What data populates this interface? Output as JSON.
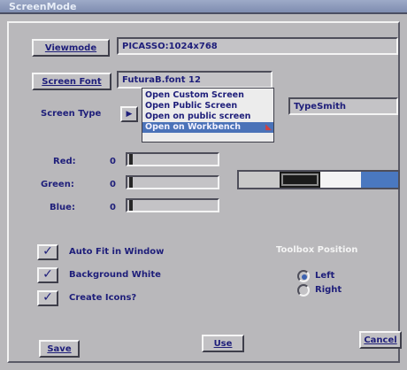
{
  "window": {
    "title": "ScreenMode"
  },
  "viewmode": {
    "button_label": "Viewmode",
    "value": "PICASSO:1024x768"
  },
  "screen_font": {
    "button_label": "Screen Font",
    "value": "FuturaB.font 12"
  },
  "screen_type": {
    "label": "Screen Type",
    "cycle_icon": "arrow-right-icon",
    "options": [
      "Open Custom Screen",
      "Open Public Screen",
      "Open on public screen",
      "Open on Workbench"
    ],
    "selected_index": 3
  },
  "public_screen_name": "TypeSmith",
  "colors": {
    "red": {
      "label": "Red:",
      "value": "0",
      "level": 0
    },
    "green": {
      "label": "Green:",
      "value": "0",
      "level": 0
    },
    "blue": {
      "label": "Blue:",
      "value": "0",
      "level": 0
    },
    "palette": [
      "#c9c9c9",
      "#1a1a1a",
      "#f4f4f4",
      "#4a78c0"
    ],
    "selected_index": 1
  },
  "options": {
    "auto_fit": {
      "label": "Auto Fit in Window",
      "checked": true
    },
    "background_white": {
      "label": "Background White",
      "checked": true
    },
    "create_icons": {
      "label": "Create Icons?",
      "checked": true
    }
  },
  "toolbox": {
    "title": "Toolbox Position",
    "left_label": "Left",
    "right_label": "Right",
    "selected": "Left"
  },
  "footer": {
    "save_label": "Save",
    "use_label": "Use",
    "cancel_label": "Cancel"
  }
}
